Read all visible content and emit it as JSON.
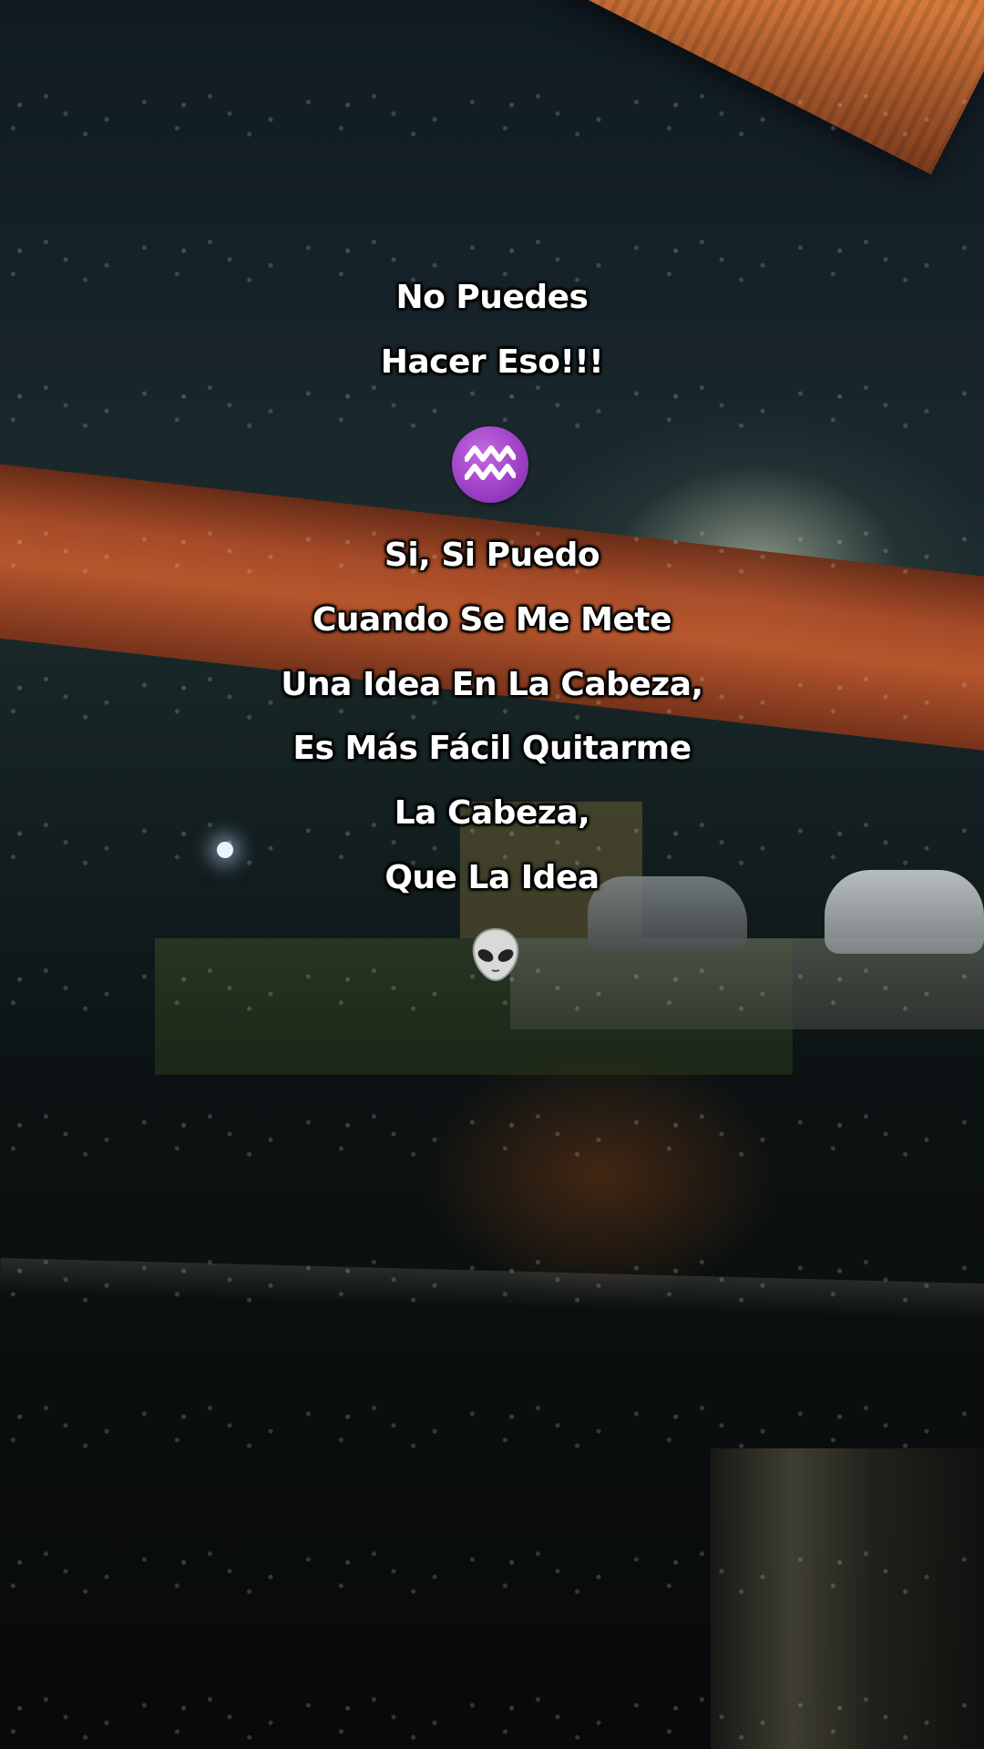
{
  "caption": {
    "lines_top": [
      "No Puedes",
      "Hacer Eso!!!"
    ],
    "separator_emoji": "aquarius-icon",
    "lines_bottom": [
      "Si, Si Puedo",
      "Cuando Se Me Mete",
      "Una Idea En La Cabeza,",
      "Es Más Fácil Quitarme",
      "La Cabeza,",
      "Que La Idea"
    ],
    "end_emoji": "alien-icon"
  },
  "colors": {
    "text": "#ffffff",
    "aquarius_badge": "#9b3ec4",
    "awning": "#c9692f"
  }
}
